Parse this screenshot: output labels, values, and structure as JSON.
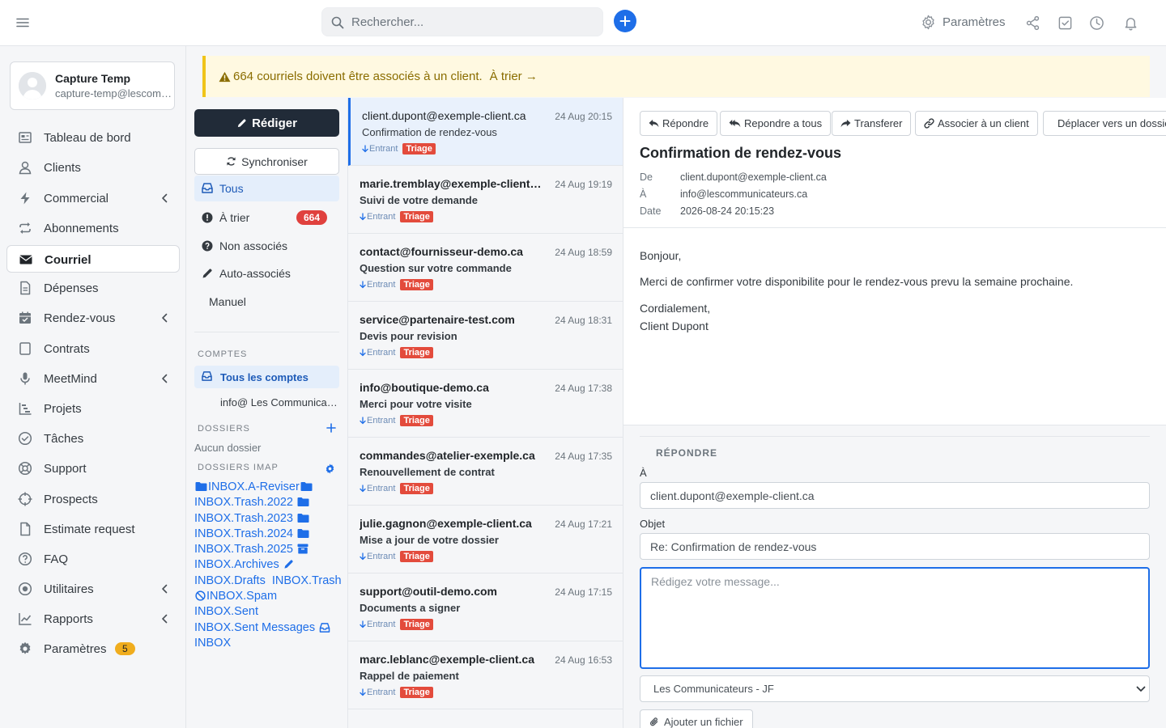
{
  "topbar": {
    "search_placeholder": "Rechercher...",
    "settings_label": "Paramètres"
  },
  "user": {
    "name": "Capture Temp",
    "email": "capture-temp@lescommunicateurs.ca"
  },
  "nav": [
    {
      "label": "Tableau de bord",
      "icon": "dashboard-icon"
    },
    {
      "label": "Clients",
      "icon": "user-icon"
    },
    {
      "label": "Commercial",
      "icon": "bolt-icon",
      "chevron": true
    },
    {
      "label": "Abonnements",
      "icon": "repeat-icon"
    },
    {
      "label": "Courriel",
      "icon": "envelope-icon",
      "active": true
    },
    {
      "label": "Dépenses",
      "icon": "file-icon"
    },
    {
      "label": "Rendez-vous",
      "icon": "calendar-icon",
      "chevron": true
    },
    {
      "label": "Contrats",
      "icon": "contract-icon"
    },
    {
      "label": "MeetMind",
      "icon": "microphone-icon",
      "chevron": true
    },
    {
      "label": "Projets",
      "icon": "gantt-icon"
    },
    {
      "label": "Tâches",
      "icon": "check-circle-icon"
    },
    {
      "label": "Support",
      "icon": "lifebuoy-icon"
    },
    {
      "label": "Prospects",
      "icon": "crosshair-icon"
    },
    {
      "label": "Estimate request",
      "icon": "document-icon"
    },
    {
      "label": "FAQ",
      "icon": "question-icon"
    },
    {
      "label": "Utilitaires",
      "icon": "dot-circle-icon",
      "chevron": true
    },
    {
      "label": "Rapports",
      "icon": "chart-line-icon",
      "chevron": true
    },
    {
      "label": "Paramètres",
      "icon": "gear-icon",
      "badge": "5"
    }
  ],
  "alert": {
    "text": "664 courriels doivent être associés à un client.",
    "link": "À trier →"
  },
  "folders": {
    "compose": "Rédiger",
    "sync": "Synchroniser",
    "items": [
      {
        "label": "Tous",
        "active": true
      },
      {
        "label": "À trier",
        "badge": "664"
      },
      {
        "label": "Non associés"
      },
      {
        "label": "Auto-associés"
      },
      {
        "label": "Manuel"
      }
    ],
    "accounts_title": "COMPTES",
    "accounts_all": "Tous les comptes",
    "account_one": "info@ Les Communicateurs",
    "dossiers_title": "DOSSIERS",
    "dossiers_empty": "Aucun dossier",
    "imap_title": "DOSSIERS IMAP",
    "imap": [
      "INBOX.A-Reviser",
      "INBOX.Trash.2022",
      "INBOX.Trash.2023",
      "INBOX.Trash.2024",
      "INBOX.Trash.2025",
      "INBOX.Archives",
      "INBOX.Drafts",
      "INBOX.Trash",
      "INBOX.Spam",
      "INBOX.Sent",
      "INBOX.Sent Messages",
      "INBOX"
    ]
  },
  "emails": [
    {
      "from": "client.dupont@exemple-client.ca",
      "date": "24 Aug 20:15",
      "subject": "Confirmation de rendez-vous",
      "direction": "Entrant",
      "tag": "Triage",
      "selected": true
    },
    {
      "from": "marie.tremblay@exemple-client.ca",
      "date": "24 Aug 19:19",
      "subject": "Suivi de votre demande",
      "direction": "Entrant",
      "tag": "Triage"
    },
    {
      "from": "contact@fournisseur-demo.ca",
      "date": "24 Aug 18:59",
      "subject": "Question sur votre commande",
      "direction": "Entrant",
      "tag": "Triage"
    },
    {
      "from": "service@partenaire-test.com",
      "date": "24 Aug 18:31",
      "subject": "Devis pour revision",
      "direction": "Entrant",
      "tag": "Triage"
    },
    {
      "from": "info@boutique-demo.ca",
      "date": "24 Aug 17:38",
      "subject": "Merci pour votre visite",
      "direction": "Entrant",
      "tag": "Triage"
    },
    {
      "from": "commandes@atelier-exemple.ca",
      "date": "24 Aug 17:35",
      "subject": "Renouvellement de contrat",
      "direction": "Entrant",
      "tag": "Triage"
    },
    {
      "from": "julie.gagnon@exemple-client.ca",
      "date": "24 Aug 17:21",
      "subject": "Mise a jour de votre dossier",
      "direction": "Entrant",
      "tag": "Triage"
    },
    {
      "from": "support@outil-demo.com",
      "date": "24 Aug 17:15",
      "subject": "Documents a signer",
      "direction": "Entrant",
      "tag": "Triage"
    },
    {
      "from": "marc.leblanc@exemple-client.ca",
      "date": "24 Aug 16:53",
      "subject": "Rappel de paiement",
      "direction": "Entrant",
      "tag": "Triage"
    }
  ],
  "reading": {
    "actions": [
      "Répondre",
      "Repondre a tous",
      "Transferer",
      "Associer à un client",
      "Déplacer vers un dossier"
    ],
    "title": "Confirmation de rendez-vous",
    "meta": [
      {
        "label": "De",
        "value": "client.dupont@exemple-client.ca"
      },
      {
        "label": "À",
        "value": "info@lescommunicateurs.ca"
      },
      {
        "label": "Date",
        "value": "2026-08-24 20:15:23"
      }
    ],
    "body": [
      "Bonjour,",
      "Merci de confirmer votre disponibilite pour le rendez-vous prevu la semaine prochaine.",
      "Cordialement,",
      "Client Dupont"
    ]
  },
  "reply": {
    "title": "RÉPONDRE",
    "to_label": "À",
    "to_value": "client.dupont@exemple-client.ca",
    "subject_label": "Objet",
    "subject_value": "Re: Confirmation de rendez-vous",
    "message_placeholder": "Rédigez votre message...",
    "from_account": "Les Communicateurs - JF",
    "attach": "Ajouter un fichier"
  },
  "colors": {
    "accent": "#1e6ee8",
    "danger": "#e0413e",
    "warning_bg": "#fff9e1",
    "dark_button": "#212b38"
  }
}
